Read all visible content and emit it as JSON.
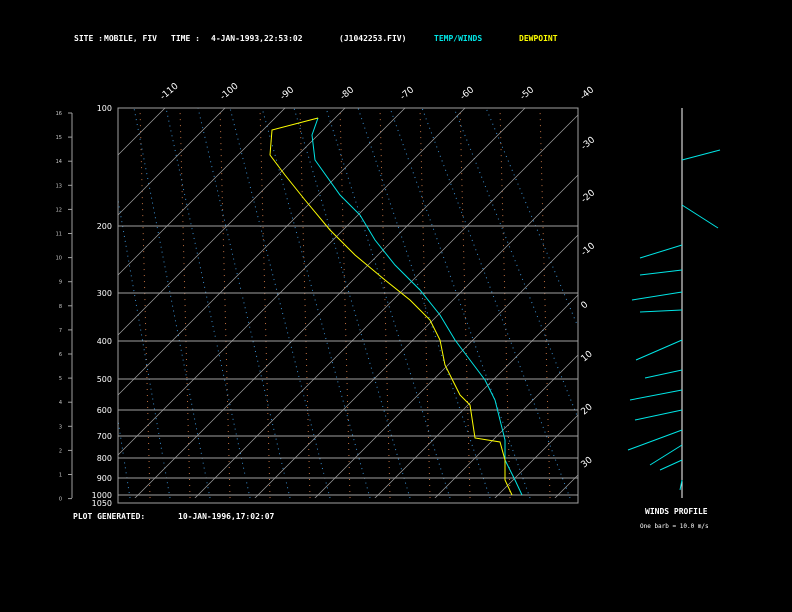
{
  "header": {
    "site_label": "SITE :",
    "site": "MOBILE, FIV",
    "time_label": "TIME :",
    "time": "4-JAN-1993,22:53:02",
    "file": "(J1042253.FIV)",
    "legend_temp": "TEMP/WINDS",
    "legend_dew": "DEWPOINT"
  },
  "footer": {
    "generated_label": "PLOT GENERATED:",
    "generated": "10-JAN-1996,17:02:07",
    "winds_title": "WINDS PROFILE",
    "barb_note": "One barb = 10.0 m/s"
  },
  "colors": {
    "temp": "#00e5e5",
    "dew": "#ffff00",
    "grid": "#a0a0a0"
  },
  "chart_data": {
    "type": "skew-t",
    "pressure_levels": [
      100,
      200,
      300,
      400,
      500,
      600,
      700,
      800,
      900,
      1000,
      1050
    ],
    "height_km": [
      16,
      15,
      14,
      13,
      12,
      11,
      10,
      9,
      8,
      7,
      6,
      5,
      4,
      3,
      2,
      1,
      0
    ],
    "isotherm_top": [
      -110,
      -100,
      -90,
      -80,
      -70,
      -60,
      -50,
      -40
    ],
    "isotherm_right": [
      -30,
      -20,
      -10,
      0,
      10,
      20,
      30
    ]
  }
}
